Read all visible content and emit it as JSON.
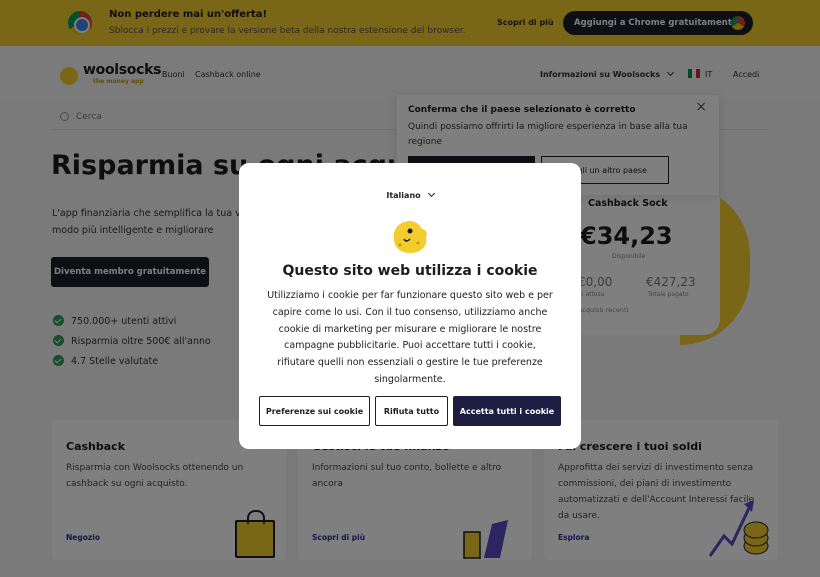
{
  "promo": {
    "title": "Non perdere mai un'offerta!",
    "subtitle": "Sblocca i prezzi e provare la versione beta della nostra estensione del browser.",
    "link": "Scopri di più",
    "button": "Aggiungi a Chrome gratuitamente!"
  },
  "nav": {
    "logo": "woolsocks",
    "logo_tagline": "the money app",
    "links": [
      "Buoni",
      "Cashback online"
    ],
    "info": "Informazioni su Woolsocks",
    "country": "IT",
    "login": "Accedi"
  },
  "search": {
    "placeholder": "Cerca"
  },
  "hero": {
    "title": "Risparmia su ogni acquisto",
    "subtitle": "L'app finanziaria che semplifica la tua vita e ti aiuta a spendere in modo più intelligente e migliorare",
    "button": "Diventa membro gratuitamente",
    "bullets": [
      "750.000+ utenti attivi",
      "Risparmia oltre 500€ all'anno",
      "4.7 Stelle valutate"
    ]
  },
  "country_popup": {
    "title": "Conferma che il paese selezionato è corretto",
    "body": "Quindi possiamo offrirti la migliore esperienza in base alla tua regione",
    "other_button": "Scegli un altro paese"
  },
  "phone": {
    "title": "Cashback Sock",
    "amount": "€34,23",
    "amount_label": "Disponibile",
    "left_value": "€0,00",
    "left_label": "In attesa",
    "right_value": "€427,23",
    "right_label": "Totale pagato",
    "recent": "Acquisti recenti"
  },
  "cards": [
    {
      "title": "Cashback",
      "body": "Risparmia con Woolsocks ottenendo un cashback su ogni acquisto.",
      "link": "Negozio"
    },
    {
      "title": "Gestisci le tue finanze",
      "body": "Informazioni sul tuo conto, bollette e altro ancora",
      "link": "Scopri di più"
    },
    {
      "title": "Fai crescere i tuoi soldi",
      "body": "Approfitta dei servizi di investimento senza commissioni, dei piani di investimento automatizzati e dell'Account Interessi facile da usare.",
      "link": "Esplora"
    }
  ],
  "cookie_modal": {
    "language": "Italiano",
    "title": "Questo sito web utilizza i cookie",
    "body": "Utilizziamo i cookie per far funzionare questo sito web e per capire come lo usi. Con il tuo consenso, utilizziamo anche cookie di marketing per misurare e migliorare le nostre campagne pubblicitarie. Puoi accettare tutti i cookie, rifiutare quelli non essenziali o gestire le tue preferenze singolarmente.",
    "preferences_button": "Preferenze sui cookie",
    "reject_button": "Rifiuta tutto",
    "accept_button": "Accetta tutti i cookie"
  },
  "colors": {
    "brand_yellow": "#f3cc2e",
    "dark_navy": "#1d1d2b",
    "accept_navy": "#1d1d42",
    "check_green": "#2e9b56"
  }
}
